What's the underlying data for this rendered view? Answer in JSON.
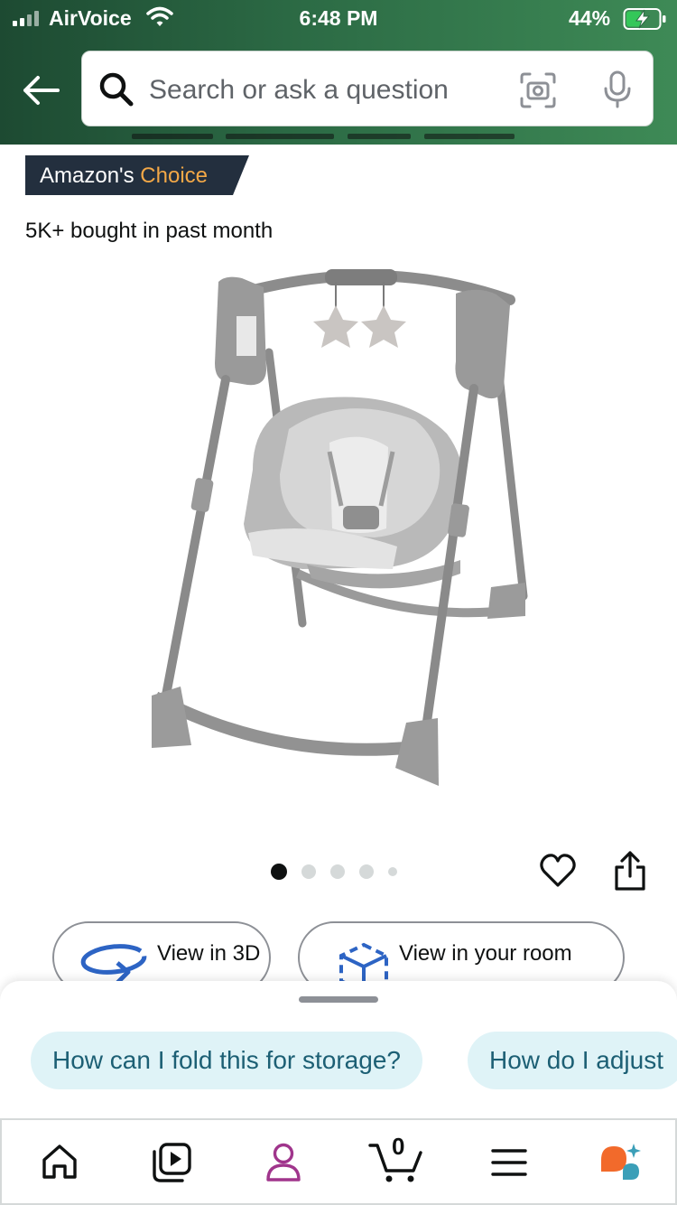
{
  "status_bar": {
    "carrier": "AirVoice",
    "time": "6:48 PM",
    "battery_percent": "44%"
  },
  "search": {
    "placeholder": "Search or ask a question"
  },
  "product": {
    "badge_prefix": "Amazon's",
    "badge_highlight": "Choice",
    "bought_text": "5K+ bought in past month",
    "image_count": 5,
    "active_image": 1
  },
  "actions": {
    "view_3d": "View in 3D",
    "view_room": "View in your room"
  },
  "suggestions": [
    "How can I fold this for storage?",
    "How do I adjust"
  ],
  "nav": {
    "cart_count": "0",
    "items": [
      "home-icon",
      "video-icon",
      "account-icon",
      "cart-icon",
      "menu-icon",
      "rufus-icon"
    ]
  },
  "colors": {
    "header_start": "#1d4a32",
    "header_end": "#3e8a56",
    "badge_bg": "#232f3e",
    "badge_accent": "#f3a847",
    "chip_bg": "#dff3f7",
    "chip_text": "#1c5f74",
    "account_icon": "#a0358c",
    "action_blue": "#2d64c4"
  }
}
